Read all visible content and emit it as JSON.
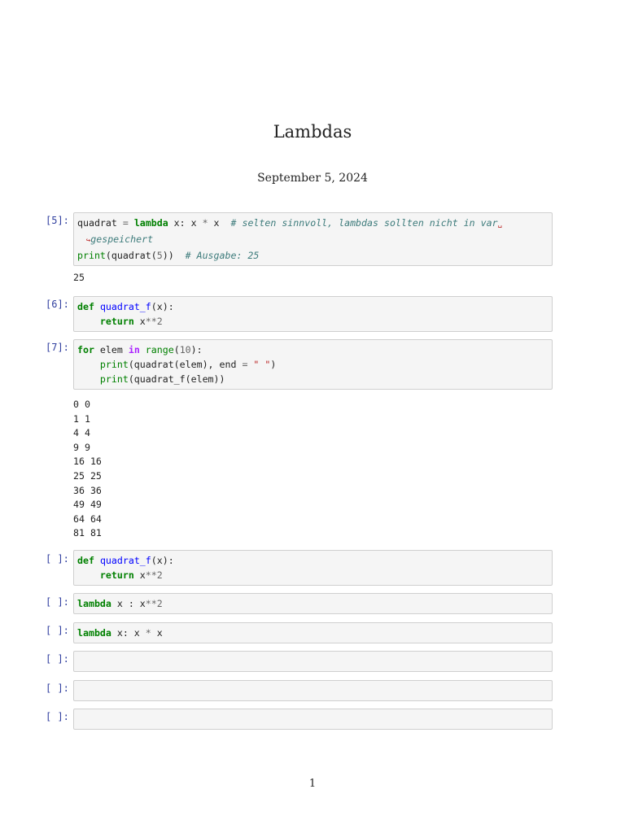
{
  "document": {
    "title": "Lambdas",
    "date": "September 5, 2024",
    "page_number": "1"
  },
  "cells": [
    {
      "prompt": "[5]:",
      "lines": [
        [
          [
            "",
            "quadrat "
          ],
          [
            "op",
            "="
          ],
          [
            "",
            " "
          ],
          [
            "kw",
            "lambda"
          ],
          [
            "",
            " x: x "
          ],
          [
            "op",
            "*"
          ],
          [
            "",
            " x  "
          ],
          [
            "cm",
            "# selten sinnvoll, lambdas sollten nicht in var"
          ],
          [
            "cont",
            "␣"
          ]
        ],
        [
          [
            "cont",
            "  ↪"
          ],
          [
            "cm",
            "gespeichert"
          ]
        ],
        [
          [
            "bi",
            "print"
          ],
          [
            "",
            "(quadrat("
          ],
          [
            "num",
            "5"
          ],
          [
            "",
            "))  "
          ],
          [
            "cm",
            "# Ausgabe: 25"
          ]
        ]
      ],
      "output": [
        "25"
      ]
    },
    {
      "prompt": "[6]:",
      "lines": [
        [
          [
            "kw",
            "def"
          ],
          [
            "",
            " "
          ],
          [
            "fn",
            "quadrat_f"
          ],
          [
            "",
            "(x):"
          ]
        ],
        [
          [
            "",
            "    "
          ],
          [
            "kw",
            "return"
          ],
          [
            "",
            " x"
          ],
          [
            "op",
            "**"
          ],
          [
            "num",
            "2"
          ]
        ]
      ]
    },
    {
      "prompt": "[7]:",
      "lines": [
        [
          [
            "kw",
            "for"
          ],
          [
            "",
            " elem "
          ],
          [
            "ow",
            "in"
          ],
          [
            "",
            " "
          ],
          [
            "bi",
            "range"
          ],
          [
            "",
            "("
          ],
          [
            "num",
            "10"
          ],
          [
            "",
            "):"
          ]
        ],
        [
          [
            "",
            "    "
          ],
          [
            "bi",
            "print"
          ],
          [
            "",
            "(quadrat(elem), end "
          ],
          [
            "op",
            "="
          ],
          [
            "",
            " "
          ],
          [
            "str",
            "\" \""
          ],
          [
            "",
            ")"
          ]
        ],
        [
          [
            "",
            "    "
          ],
          [
            "bi",
            "print"
          ],
          [
            "",
            "(quadrat_f(elem))"
          ]
        ]
      ],
      "output": [
        "0 0",
        "1 1",
        "4 4",
        "9 9",
        "16 16",
        "25 25",
        "36 36",
        "49 49",
        "64 64",
        "81 81"
      ]
    },
    {
      "prompt": "[ ]:",
      "lines": [
        [
          [
            "kw",
            "def"
          ],
          [
            "",
            " "
          ],
          [
            "fn",
            "quadrat_f"
          ],
          [
            "",
            "(x):"
          ]
        ],
        [
          [
            "",
            "    "
          ],
          [
            "kw",
            "return"
          ],
          [
            "",
            " x"
          ],
          [
            "op",
            "**"
          ],
          [
            "num",
            "2"
          ]
        ]
      ]
    },
    {
      "prompt": "[ ]:",
      "lines": [
        [
          [
            "kw",
            "lambda"
          ],
          [
            "",
            " x : x"
          ],
          [
            "op",
            "**"
          ],
          [
            "num",
            "2"
          ]
        ]
      ]
    },
    {
      "prompt": "[ ]:",
      "lines": [
        [
          [
            "kw",
            "lambda"
          ],
          [
            "",
            " x: x "
          ],
          [
            "op",
            "*"
          ],
          [
            "",
            " x"
          ]
        ]
      ]
    },
    {
      "prompt": "[ ]:",
      "lines": [
        [
          [
            "",
            ""
          ]
        ]
      ]
    },
    {
      "prompt": "[ ]:",
      "lines": [
        [
          [
            "",
            ""
          ]
        ]
      ]
    },
    {
      "prompt": "[ ]:",
      "lines": [
        [
          [
            "",
            ""
          ]
        ]
      ]
    }
  ]
}
